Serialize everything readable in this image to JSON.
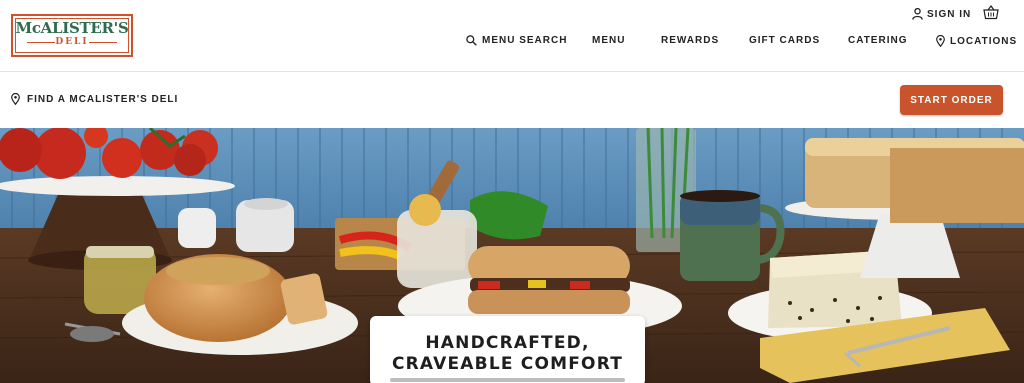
{
  "brand": {
    "logo_top": "McALISTER'S",
    "logo_bottom": "DELI",
    "accent_color": "#c9532a",
    "green_color": "#2e6b4f"
  },
  "utility": {
    "sign_in": "SIGN IN",
    "sign_in_icon": "user-icon",
    "basket_icon": "basket-icon"
  },
  "nav": {
    "items": [
      {
        "label": "MENU SEARCH",
        "icon": "search-icon"
      },
      {
        "label": "MENU"
      },
      {
        "label": "REWARDS"
      },
      {
        "label": "GIFT CARDS"
      },
      {
        "label": "CATERING"
      },
      {
        "label": "LOCATIONS",
        "icon": "location-pin-icon"
      }
    ]
  },
  "subbar": {
    "find_label": "FIND A MCALISTER'S DELI",
    "find_icon": "location-pin-icon",
    "start_order": "START ORDER"
  },
  "hero": {
    "title": "HANDCRAFTED, CRAVEABLE COMFORT"
  }
}
